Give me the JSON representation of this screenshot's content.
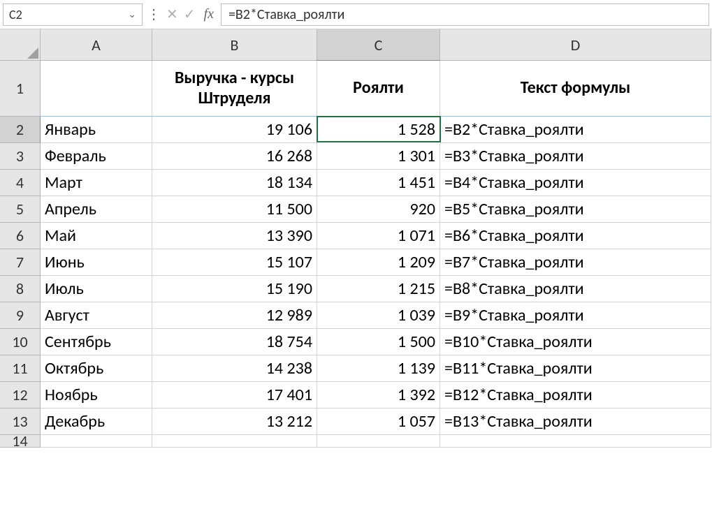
{
  "formulaBar": {
    "nameBox": "C2",
    "formula": "=B2*Ставка_роялти",
    "fxLabel": "fx"
  },
  "columns": [
    "A",
    "B",
    "C",
    "D"
  ],
  "selectedColumn": "C",
  "selectedRow": "2",
  "headers": {
    "colA": "",
    "colB_line1": "Выручка - курсы",
    "colB_line2": "Штруделя",
    "colC": "Роялти",
    "colD": "Текст формулы"
  },
  "rows": [
    {
      "num": "1"
    },
    {
      "num": "2",
      "month": "Январь",
      "revenue": "19 106",
      "royalty": "1 528",
      "formula": "=B2*Ставка_роялти"
    },
    {
      "num": "3",
      "month": "Февраль",
      "revenue": "16 268",
      "royalty": "1 301",
      "formula": "=B3*Ставка_роялти"
    },
    {
      "num": "4",
      "month": "Март",
      "revenue": "18 134",
      "royalty": "1 451",
      "formula": "=B4*Ставка_роялти"
    },
    {
      "num": "5",
      "month": "Апрель",
      "revenue": "11 500",
      "royalty": "920",
      "formula": "=B5*Ставка_роялти"
    },
    {
      "num": "6",
      "month": "Май",
      "revenue": "13 390",
      "royalty": "1 071",
      "formula": "=B6*Ставка_роялти"
    },
    {
      "num": "7",
      "month": "Июнь",
      "revenue": "15 107",
      "royalty": "1 209",
      "formula": "=B7*Ставка_роялти"
    },
    {
      "num": "8",
      "month": "Июль",
      "revenue": "15 190",
      "royalty": "1 215",
      "formula": "=B8*Ставка_роялти"
    },
    {
      "num": "9",
      "month": "Август",
      "revenue": "12 989",
      "royalty": "1 039",
      "formula": "=B9*Ставка_роялти"
    },
    {
      "num": "10",
      "month": "Сентябрь",
      "revenue": "18 754",
      "royalty": "1 500",
      "formula": "=B10*Ставка_роялти"
    },
    {
      "num": "11",
      "month": "Октябрь",
      "revenue": "14 238",
      "royalty": "1 139",
      "formula": "=B11*Ставка_роялти"
    },
    {
      "num": "12",
      "month": "Ноябрь",
      "revenue": "17 401",
      "royalty": "1 392",
      "formula": "=B12*Ставка_роялти"
    },
    {
      "num": "13",
      "month": "Декабрь",
      "revenue": "13 212",
      "royalty": "1 057",
      "formula": "=B13*Ставка_роялти"
    },
    {
      "num": "14"
    }
  ]
}
